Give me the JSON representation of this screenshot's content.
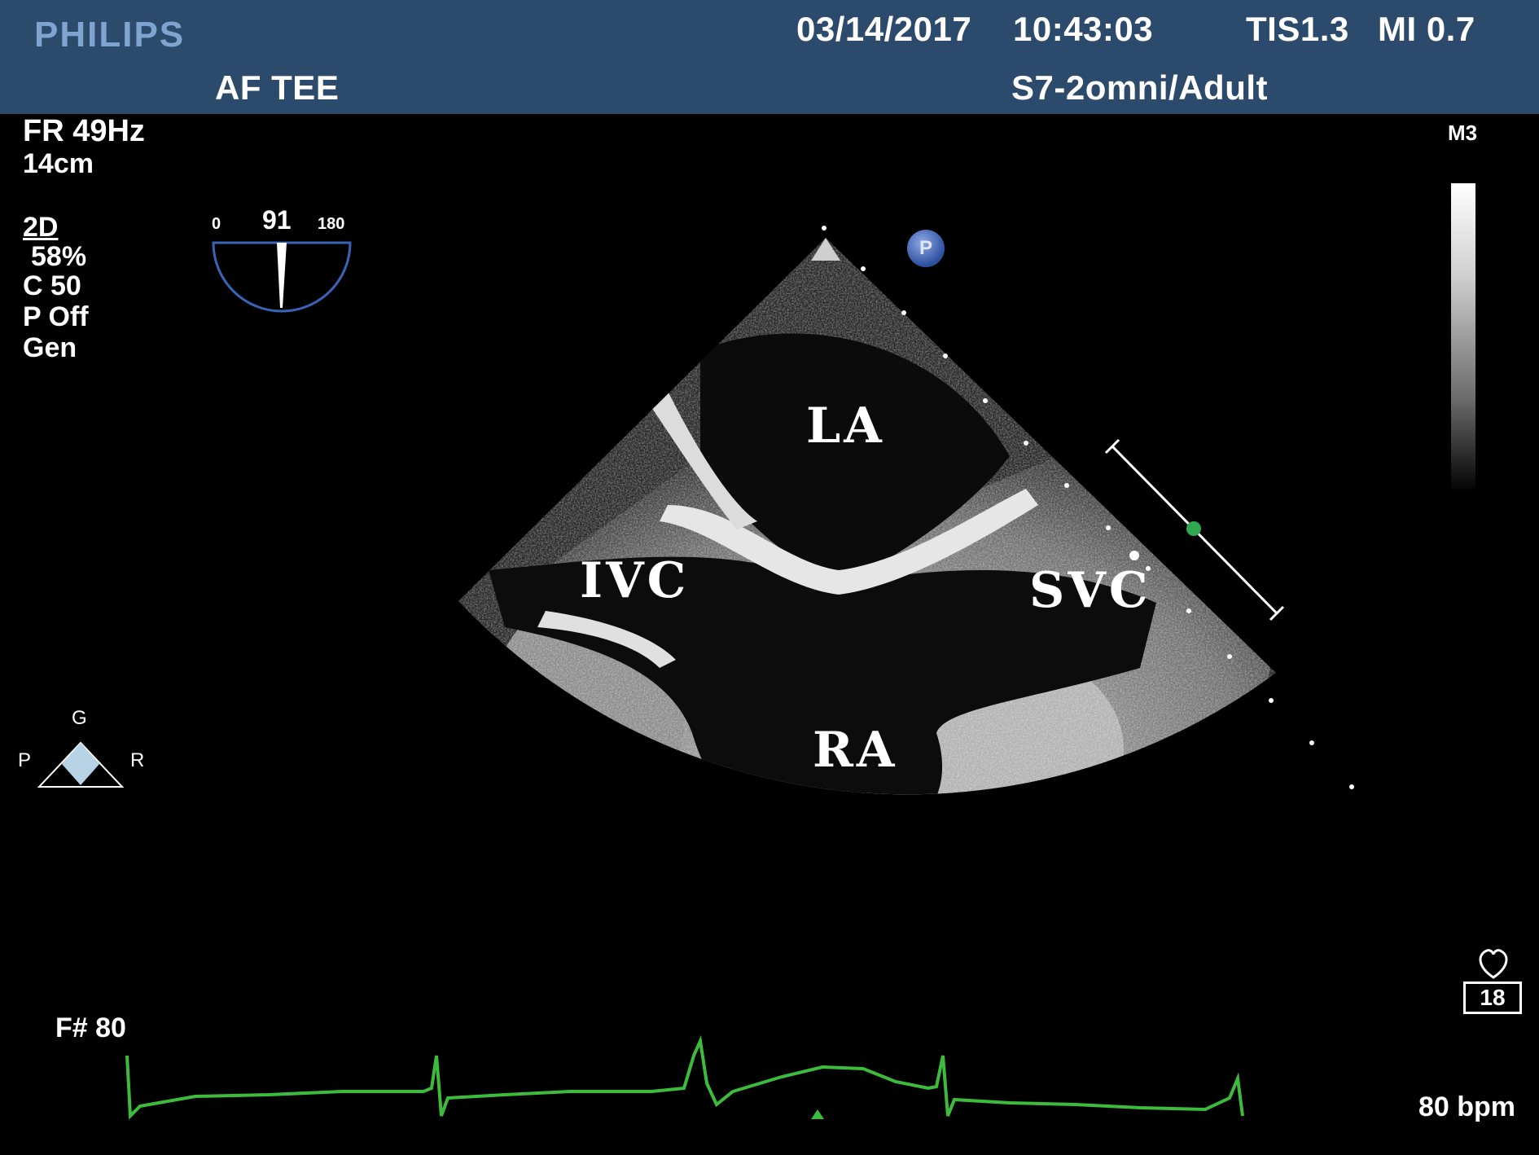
{
  "header": {
    "brand": "PHILIPS",
    "date": "03/14/2017",
    "time": "10:43:03",
    "tis": "TIS1.3",
    "mi": "MI 0.7",
    "study": "AF TEE",
    "probe": "S7-2omni/Adult"
  },
  "params": {
    "frame_rate": "FR 49Hz",
    "depth": "14cm",
    "mode": "2D",
    "gain": "58%",
    "compress": "C 50",
    "persist": "P Off",
    "resolution": "Gen"
  },
  "angle_indicator": {
    "min_label": "0",
    "value": "91",
    "max_label": "180"
  },
  "orientation": {
    "top": "G",
    "left": "P",
    "right": "R"
  },
  "chambers": {
    "la": "LA",
    "ivc": "IVC",
    "svc": "SVC",
    "ra": "RA"
  },
  "right_panel": {
    "probe_mode": "M3",
    "heart_cycle": "18"
  },
  "p_marker": "P",
  "ecg": {
    "frame_label": "F# 80",
    "heart_rate": "80 bpm",
    "color": "#3dbb3d"
  }
}
